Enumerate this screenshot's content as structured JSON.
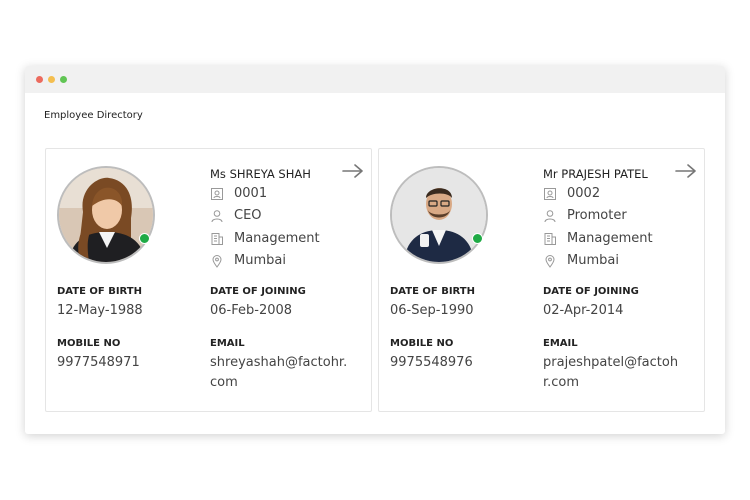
{
  "window": {
    "title_dots": [
      "red",
      "yellow",
      "green"
    ]
  },
  "app": {
    "title": "Employee Directory"
  },
  "employees": [
    {
      "name": "Ms SHREYA SHAH",
      "code": "0001",
      "role": "CEO",
      "department": "Management",
      "location": "Mumbai",
      "labels": {
        "dob": "DATE OF BIRTH",
        "doj": "DATE OF JOINING",
        "mobile": "MOBILE NO",
        "email": "EMAIL"
      },
      "dob": "12-May-1988",
      "doj": "06-Feb-2008",
      "mobile": "9977548971",
      "email": "shreyashah@factohr.com",
      "status_color": "#1faa45"
    },
    {
      "name": "Mr PRAJESH PATEL",
      "code": "0002",
      "role": "Promoter",
      "department": "Management",
      "location": "Mumbai",
      "labels": {
        "dob": "DATE OF BIRTH",
        "doj": "DATE OF JOINING",
        "mobile": "MOBILE NO",
        "email": "EMAIL"
      },
      "dob": "06-Sep-1990",
      "doj": "02-Apr-2014",
      "mobile": "9975548976",
      "email": "prajeshpatel@factohr.com",
      "status_color": "#1faa45"
    }
  ],
  "icons": {
    "code": "id-badge-icon",
    "role": "person-icon",
    "department": "building-icon",
    "location": "map-pin-icon",
    "open": "arrow-right-icon"
  }
}
